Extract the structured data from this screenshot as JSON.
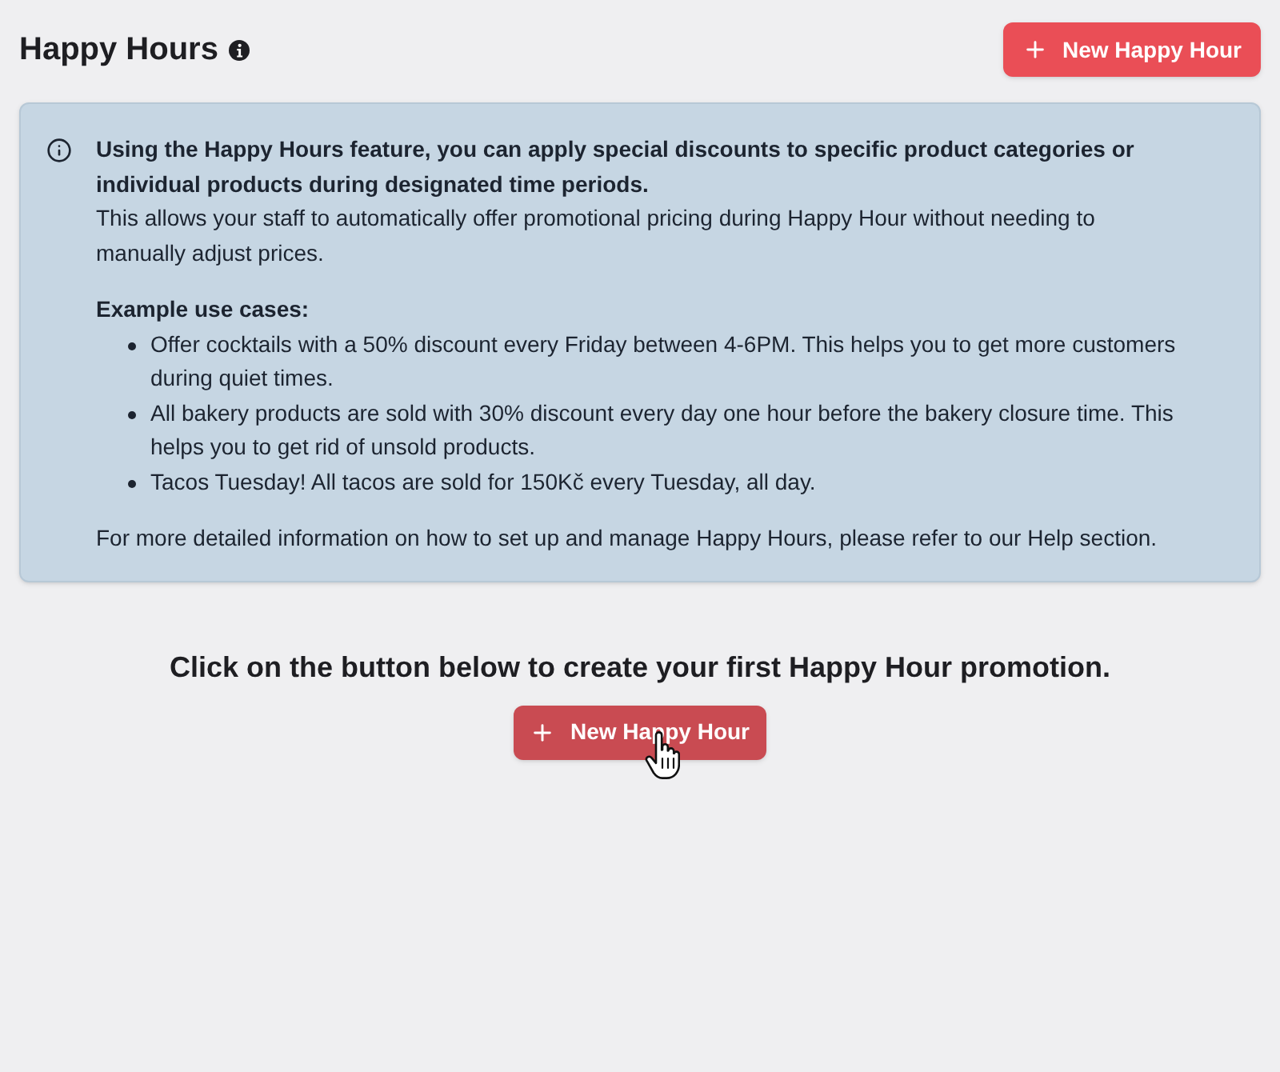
{
  "header": {
    "title": "Happy Hours",
    "new_button": {
      "label": "New Happy Hour"
    }
  },
  "info_box": {
    "intro_bold": "Using the Happy Hours feature, you can apply special discounts to specific product categories or individual products during designated time periods.",
    "intro": "This allows your staff to automatically offer promotional pricing during Happy Hour without needing to manually adjust prices.",
    "examples_heading": "Example use cases:",
    "examples": [
      "Offer cocktails with a 50% discount every Friday between 4-6PM. This helps you to get more customers during quiet times.",
      "All bakery products are sold with 30% discount every day one hour before the bakery closure time. This helps you to get rid of unsold products.",
      "Tacos Tuesday! All tacos are sold for 150Kč every Tuesday, all day."
    ],
    "footer": "For more detailed information on how to set up and manage Happy Hours, please refer to our Help section."
  },
  "empty_state": {
    "message": "Click on the button below to create your first Happy Hour promotion.",
    "button": {
      "label": "New Happy Hour",
      "hovered": true
    }
  }
}
